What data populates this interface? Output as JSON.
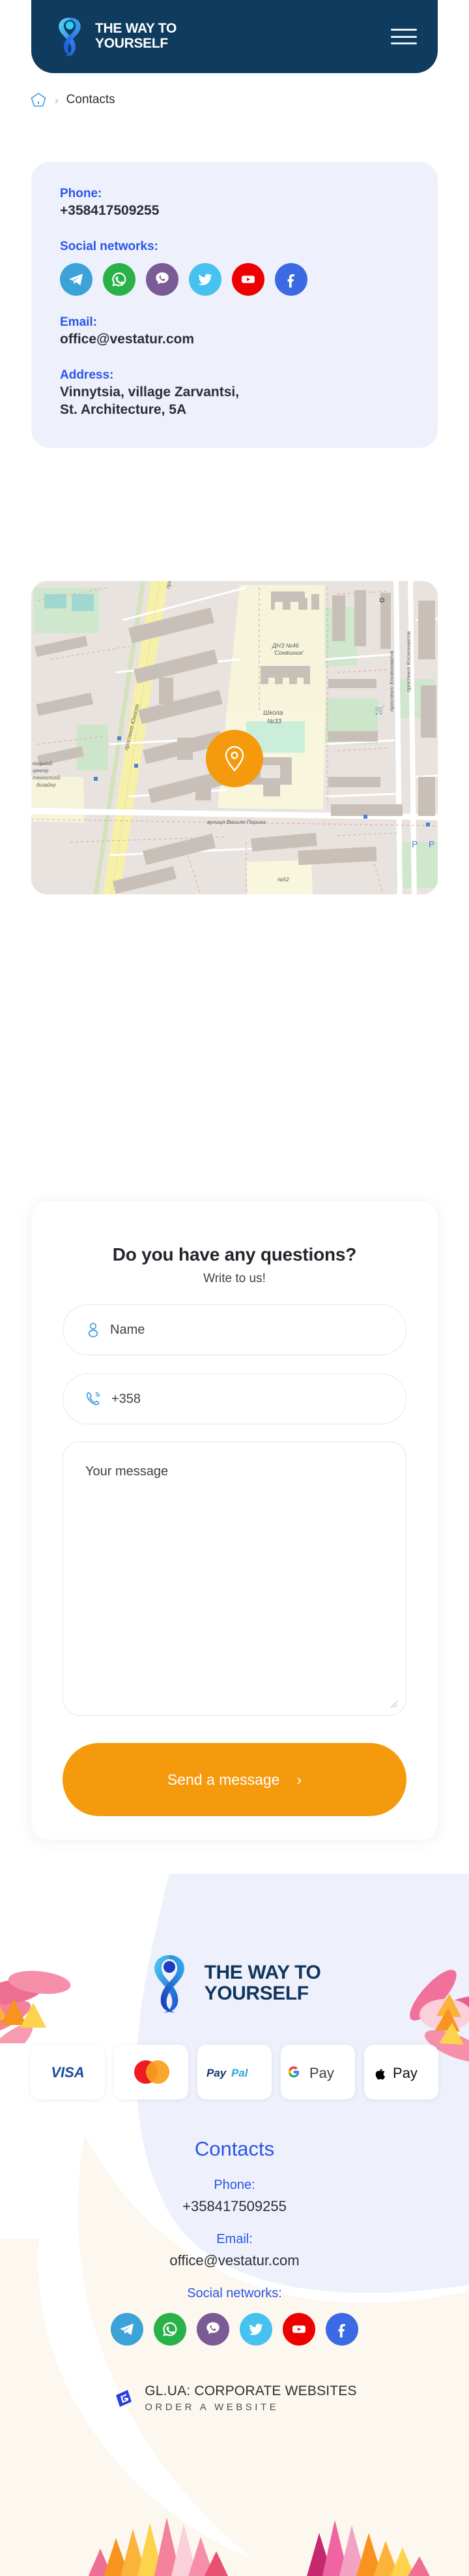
{
  "header": {
    "brand_line1": "THE WAY TO",
    "brand_line2": "YOURSELF",
    "logo_icon": "ribbon-person-logo",
    "menu_icon": "hamburger-menu-icon"
  },
  "breadcrumb": {
    "home_icon": "home-icon",
    "separator": "›",
    "current": "Contacts"
  },
  "contact_card": {
    "phone_label": "Phone:",
    "phone_value": "+358417509255",
    "social_label": "Social networks:",
    "email_label": "Email:",
    "email_value": "office@vestatur.com",
    "address_label": "Address:",
    "address_line1": "Vinnytsia, village Zarvantsi,",
    "address_line2": "St. Architecture, 5A",
    "socials": [
      {
        "name": "telegram",
        "icon": "telegram-icon",
        "color": "#3ba3d8"
      },
      {
        "name": "whatsapp",
        "icon": "whatsapp-icon",
        "color": "#2ab24a"
      },
      {
        "name": "viber",
        "icon": "viber-icon",
        "color": "#7a5b96"
      },
      {
        "name": "twitter",
        "icon": "twitter-icon",
        "color": "#45c2f0"
      },
      {
        "name": "youtube",
        "icon": "youtube-icon",
        "color": "#ef0000"
      },
      {
        "name": "facebook",
        "icon": "facebook-icon",
        "color": "#3b6ae4"
      }
    ]
  },
  "map": {
    "marker_icon": "map-pin-marker-icon",
    "marker_color": "#f59a0c",
    "labels": [
      "ДНЗ №46 'Соняшник'",
      "Школа №33",
      "проспект Юності",
      "проспект Космонавтів",
      "вулиця Василя Порика",
      "№52"
    ]
  },
  "form": {
    "title": "Do you have any questions?",
    "subtitle": "Write to us!",
    "name_placeholder": "Name",
    "name_icon": "user-icon",
    "phone_value": "+358",
    "phone_icon": "phone-call-icon",
    "message_placeholder": "Your message",
    "submit_label": "Send a message",
    "submit_arrow": "›",
    "accent_color": "#f59a0c"
  },
  "footer": {
    "brand_line1": "THE WAY TO",
    "brand_line2": "YOURSELF",
    "logo_icon": "ribbon-person-logo",
    "payments": [
      {
        "name": "visa",
        "icon": "visa-icon",
        "label": "VISA"
      },
      {
        "name": "mastercard",
        "icon": "mastercard-icon",
        "label": ""
      },
      {
        "name": "paypal",
        "icon": "paypal-icon",
        "label": "PayPal"
      },
      {
        "name": "google-pay",
        "icon": "google-pay-icon",
        "label": "Pay"
      },
      {
        "name": "apple-pay",
        "icon": "apple-pay-icon",
        "label": "Pay"
      }
    ],
    "contacts_title": "Contacts",
    "phone_label": "Phone:",
    "phone_value": "+358417509255",
    "email_label": "Email:",
    "email_value": "office@vestatur.com",
    "social_label": "Social networks:",
    "socials": [
      {
        "name": "telegram",
        "icon": "telegram-icon",
        "color": "#3ba3d8"
      },
      {
        "name": "whatsapp",
        "icon": "whatsapp-icon",
        "color": "#2ab24a"
      },
      {
        "name": "viber",
        "icon": "viber-icon",
        "color": "#7a5b96"
      },
      {
        "name": "twitter",
        "icon": "twitter-icon",
        "color": "#45c2f0"
      },
      {
        "name": "youtube",
        "icon": "youtube-icon",
        "color": "#ef0000"
      },
      {
        "name": "facebook",
        "icon": "facebook-icon",
        "color": "#3b6ae4"
      }
    ],
    "credit_icon": "gl-ua-logo-icon",
    "credit_main": "GL.UA: CORPORATE WEBSITES",
    "credit_sub": "ORDER A WEBSITE"
  },
  "colors": {
    "brand_navy": "#0e3b5e",
    "accent_blue": "#2a54e8",
    "accent_orange": "#f59a0c",
    "card_bg": "#eef1fb"
  }
}
